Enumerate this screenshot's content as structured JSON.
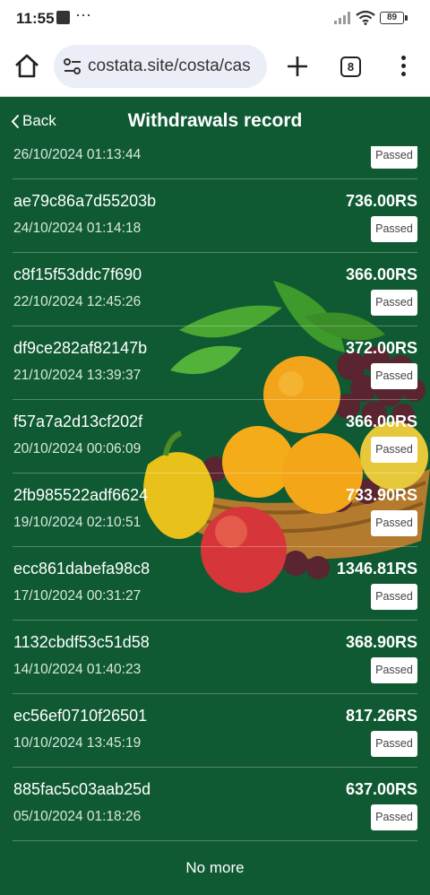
{
  "status_bar": {
    "time": "11:55",
    "dots": "⋯",
    "battery": "89"
  },
  "browser": {
    "url": "costata.site/costa/cas",
    "tab_count": "8"
  },
  "header": {
    "back_label": "Back",
    "title": "Withdrawals record"
  },
  "records": [
    {
      "id": "",
      "date": "26/10/2024 01:13:44",
      "amount": "",
      "status": "Passed"
    },
    {
      "id": "ae79c86a7d55203b",
      "date": "24/10/2024 01:14:18",
      "amount": "736.00RS",
      "status": "Passed"
    },
    {
      "id": "c8f15f53ddc7f690",
      "date": "22/10/2024 12:45:26",
      "amount": "366.00RS",
      "status": "Passed"
    },
    {
      "id": "df9ce282af82147b",
      "date": "21/10/2024 13:39:37",
      "amount": "372.00RS",
      "status": "Passed"
    },
    {
      "id": "f57a7a2d13cf202f",
      "date": "20/10/2024 00:06:09",
      "amount": "366.00RS",
      "status": "Passed"
    },
    {
      "id": "2fb985522adf6624",
      "date": "19/10/2024 02:10:51",
      "amount": "733.90RS",
      "status": "Passed"
    },
    {
      "id": "ecc861dabefa98c8",
      "date": "17/10/2024 00:31:27",
      "amount": "1346.81RS",
      "status": "Passed"
    },
    {
      "id": "1132cbdf53c51d58",
      "date": "14/10/2024 01:40:23",
      "amount": "368.90RS",
      "status": "Passed"
    },
    {
      "id": "ec56ef0710f26501",
      "date": "10/10/2024 13:45:19",
      "amount": "817.26RS",
      "status": "Passed"
    },
    {
      "id": "885fac5c03aab25d",
      "date": "05/10/2024 01:18:26",
      "amount": "637.00RS",
      "status": "Passed"
    }
  ],
  "footer": {
    "no_more": "No more"
  },
  "colors": {
    "background": "#0f5a32",
    "text": "#ffffff"
  }
}
